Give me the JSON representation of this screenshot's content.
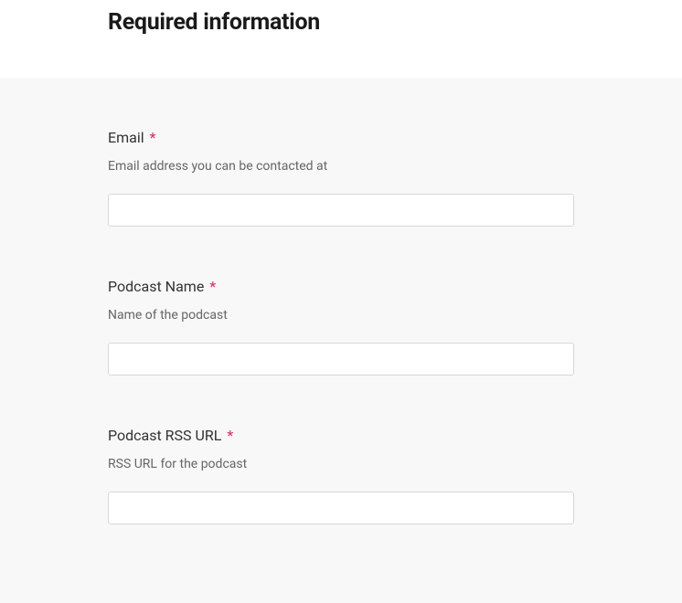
{
  "header": {
    "title": "Required information"
  },
  "form": {
    "fields": [
      {
        "label": "Email",
        "required": "*",
        "description": "Email address you can be contacted at",
        "value": ""
      },
      {
        "label": "Podcast Name",
        "required": "*",
        "description": "Name of the podcast",
        "value": ""
      },
      {
        "label": "Podcast RSS URL",
        "required": "*",
        "description": "RSS URL for the podcast",
        "value": ""
      }
    ]
  }
}
